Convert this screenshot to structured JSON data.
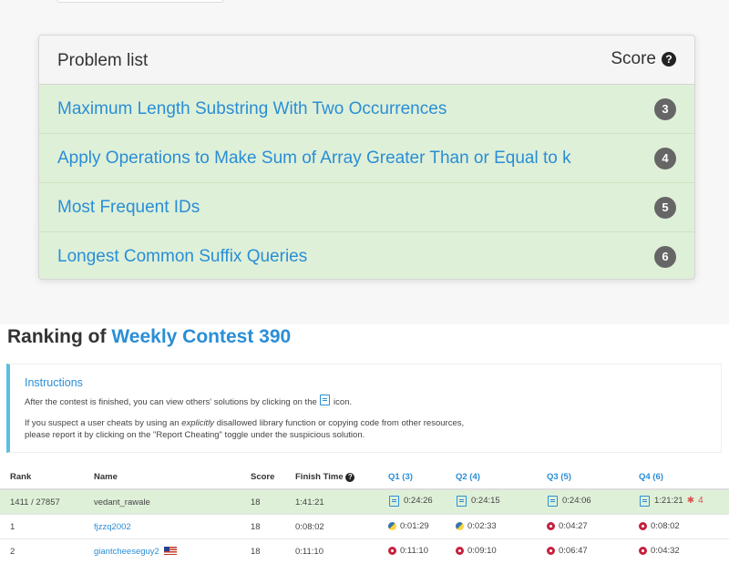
{
  "problem_panel": {
    "title": "Problem list",
    "score_label": "Score",
    "problems": [
      {
        "name": "Maximum Length Substring With Two Occurrences",
        "score": "3"
      },
      {
        "name": "Apply Operations to Make Sum of Array Greater Than or Equal to k",
        "score": "4"
      },
      {
        "name": "Most Frequent IDs",
        "score": "5"
      },
      {
        "name": "Longest Common Suffix Queries",
        "score": "6"
      }
    ]
  },
  "ranking": {
    "title_prefix": "Ranking of",
    "contest_name": "Weekly Contest 390"
  },
  "instructions": {
    "title": "Instructions",
    "p1_before": "After the contest is finished, you can view others' solutions by clicking on the",
    "p1_after": "icon.",
    "p2_before": "If you suspect a user cheats by using an",
    "p2_em": "explicitly",
    "p2_after": "disallowed library function or copying code from other resources,",
    "p2_line2": "please report it by clicking on the \"Report Cheating\" toggle under the suspicious solution."
  },
  "table": {
    "headers": {
      "rank": "Rank",
      "name": "Name",
      "score": "Score",
      "finish_time": "Finish Time",
      "q1": "Q1 (3)",
      "q2": "Q2 (4)",
      "q3": "Q3 (5)",
      "q4": "Q4 (6)"
    },
    "rows": [
      {
        "rank": "1411 / 27857",
        "name": "vedant_rawale",
        "score": "18",
        "finish": "1:41:21",
        "q1": "0:24:26",
        "q2": "0:24:15",
        "q3": "0:24:06",
        "q4": "1:21:21",
        "q4_bugs": "4"
      },
      {
        "rank": "1",
        "name": "fjzzq2002",
        "score": "18",
        "finish": "0:08:02",
        "q1": "0:01:29",
        "q2": "0:02:33",
        "q3": "0:04:27",
        "q4": "0:08:02"
      },
      {
        "rank": "2",
        "name": "giantcheeseguy2",
        "score": "18",
        "finish": "0:11:10",
        "q1": "0:11:10",
        "q2": "0:09:10",
        "q3": "0:06:47",
        "q4": "0:04:32"
      }
    ]
  },
  "colors": {
    "link_blue": "#2a8ed6",
    "solved_green": "#dff0d8",
    "info_border": "#5bc0de",
    "cpp_icon": "#c3223f",
    "bug_red": "#d9534f"
  }
}
